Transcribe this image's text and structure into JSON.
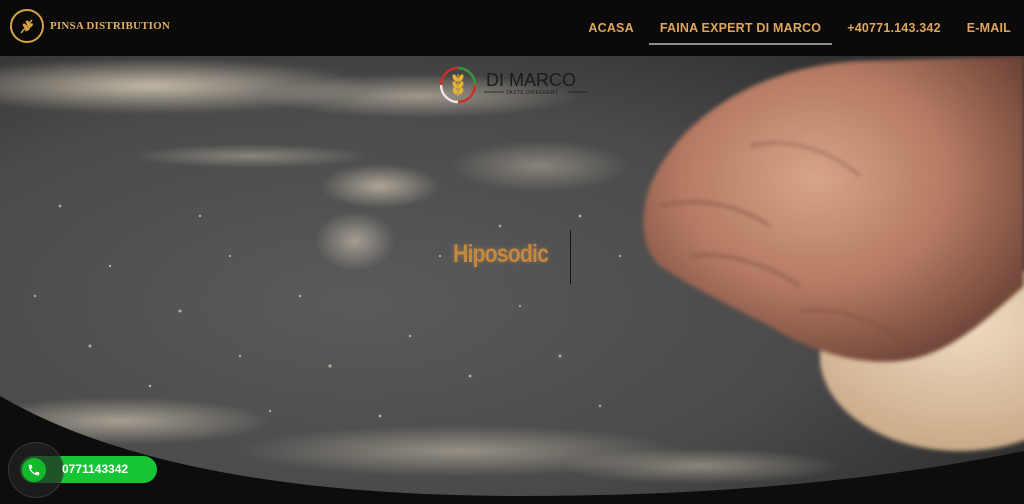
{
  "brand": {
    "name": "PINSA DISTRIBUTION",
    "logo_icon": "wheat-icon"
  },
  "nav": {
    "items": [
      {
        "label": "ACASA",
        "active": false
      },
      {
        "label": "FAINA EXPERT DI MARCO",
        "active": true
      },
      {
        "label": "+40771.143.342",
        "active": false
      },
      {
        "label": "E-MAIL",
        "active": false
      }
    ]
  },
  "hero": {
    "logo_brand": "DI MARCO",
    "logo_tagline": "TASTE DIFFERENT",
    "logo_icon": "wheat-icon",
    "rotating_word": "Hiposodic",
    "background": "hands-kneading-dough-photo"
  },
  "call_button": {
    "number": "0771143342",
    "icon": "phone-icon",
    "color": "#16c534"
  },
  "colors": {
    "accent": "#dfa55a",
    "header_bg": "#0a0a0a",
    "whatsapp_green": "#16c534"
  }
}
